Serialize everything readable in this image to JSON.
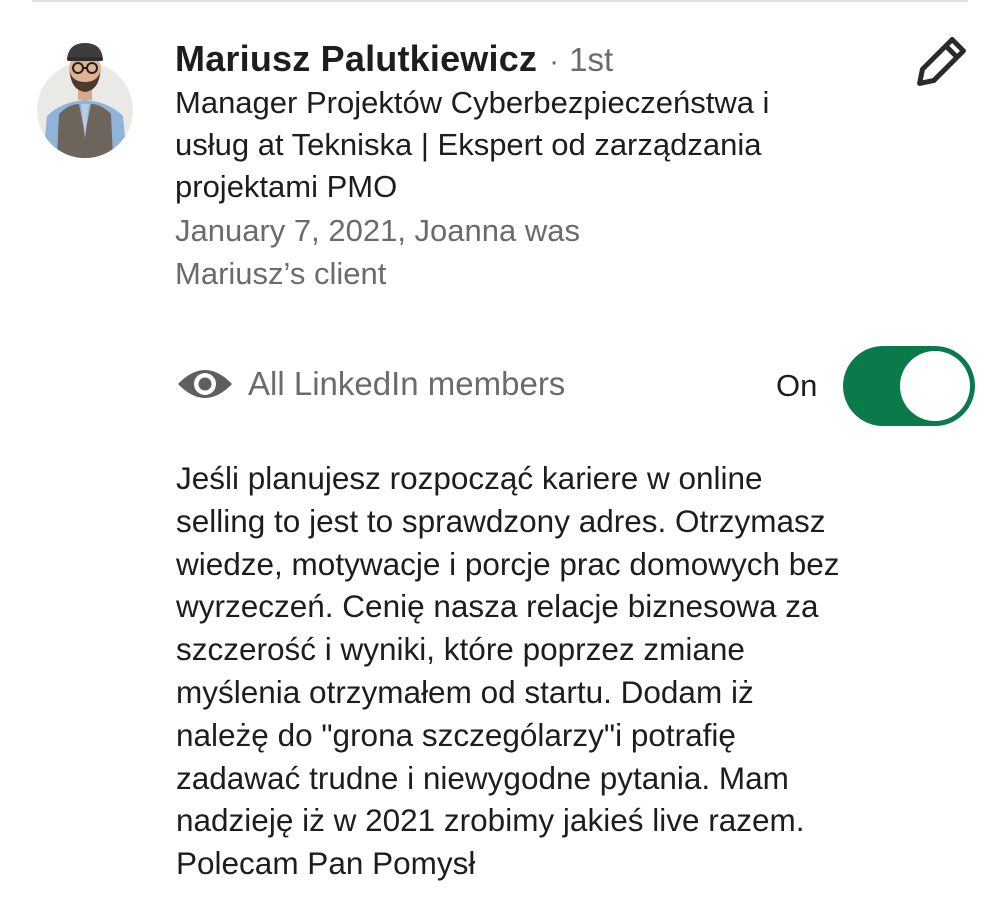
{
  "recommendation": {
    "author_name": "Mariusz Palutkiewicz",
    "separator": "·",
    "connection_degree": "1st",
    "headline": "Manager Projektów Cyberbezpieczeństwa i usług at Tekniska | Ekspert od zarządzania projektami PMO",
    "relationship": "January 7, 2021, Joanna was Mariusz’s client",
    "visibility_label": "All LinkedIn members",
    "toggle_label": "On",
    "toggle_on": true,
    "body": "Jeśli planujesz rozpocząć kariere w online\nselling to jest to sprawdzony adres. Otrzymasz\nwiedze, motywacje i porcje prac domowych bez\nwyrzeczeń. Cenię nasza relacje biznesowa za\nszczerość i wyniki, które poprzez zmiane\nmyślenia otrzymałem od startu. Dodam iż\nnależę do \"grona szczególarzy\"i potrafię\nzadawać trudne i niewygodne pytania. Mam\nnadzieję iż w 2021 zrobimy jakieś live razem.\nPolecam Pan Pomysł"
  },
  "icons": {
    "edit": "pencil-icon",
    "visibility": "eye-icon",
    "avatar": "profile-photo"
  },
  "colors": {
    "toggle_on": "#0a7a4a",
    "secondary_text": "#6b6b6b",
    "primary_text": "#1d1d1d"
  }
}
